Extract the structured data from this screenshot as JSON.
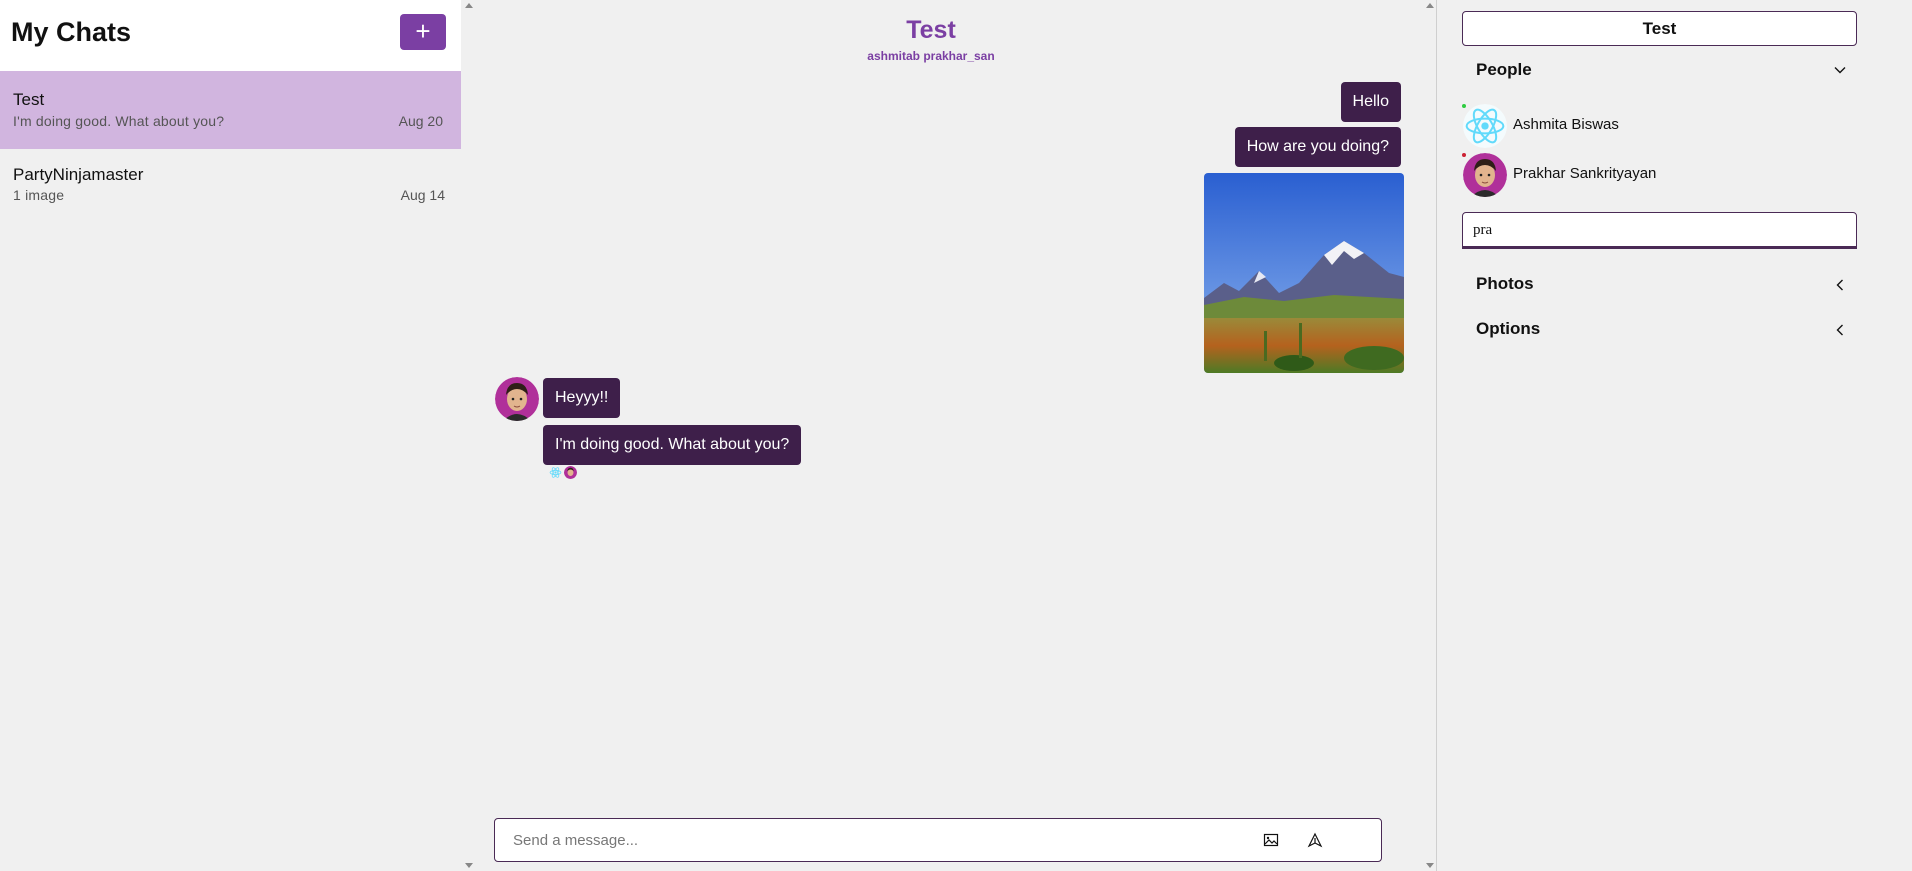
{
  "sidebar": {
    "title": "My Chats",
    "new_chat_label": "+",
    "chats": [
      {
        "name": "Test",
        "preview": "I'm doing good. What about you?",
        "date": "Aug 20"
      },
      {
        "name": "PartyNinjamaster",
        "preview": "1 image",
        "date": "Aug 14"
      }
    ]
  },
  "conversation": {
    "title": "Test",
    "members_line": "ashmitab prakhar_san",
    "messages": {
      "m1": "Hello",
      "m2": "How are you doing?",
      "m3": "Heyyy!!",
      "m4": "I'm doing good. What about you?"
    },
    "composer": {
      "placeholder": "Send a message..."
    }
  },
  "details": {
    "room_name": "Test",
    "people_label": "People",
    "people": [
      {
        "name": "Ashmita Biswas"
      },
      {
        "name": "Prakhar Sankrityayan"
      }
    ],
    "search_value": "pra",
    "photos_label": "Photos",
    "options_label": "Options"
  },
  "colors": {
    "accent": "#7b3fa3",
    "active_chat": "#d1b5df",
    "bubble": "#3e1f4a",
    "online": "#2ecc40",
    "offline": "#cc2233"
  },
  "icons": {
    "new_chat": "plus-icon",
    "people_toggle": "chevron-down-icon",
    "photos_toggle": "chevron-left-icon",
    "options_toggle": "chevron-left-icon",
    "attach": "image-icon",
    "send": "send-icon"
  }
}
